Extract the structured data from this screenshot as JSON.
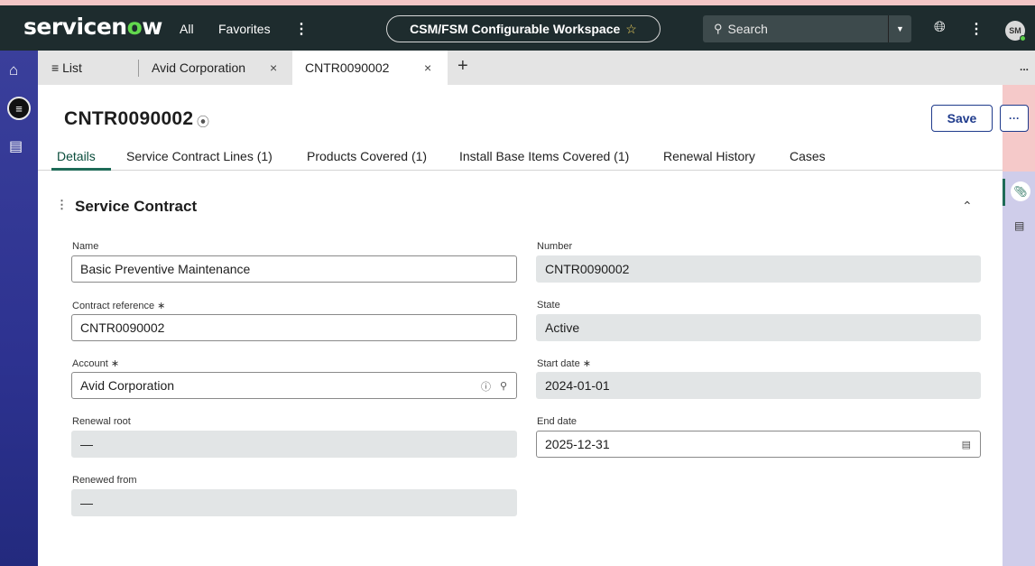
{
  "header": {
    "logo_text": "servicen",
    "logo_o": "o",
    "logo_tail": "w",
    "nav_all": "All",
    "nav_favorites": "Favorites",
    "nav_more": "⋮",
    "workspace_label": "CSM/FSM Configurable Workspace",
    "workspace_star": "☆",
    "search_placeholder": "Search",
    "avatar_initials": "SM"
  },
  "tabs": {
    "list_label": "List",
    "items": [
      {
        "label": "Avid Corporation",
        "close": "×"
      },
      {
        "label": "CNTR0090002",
        "close": "×"
      }
    ],
    "add": "+",
    "more": "..."
  },
  "record": {
    "title": "CNTR0090002",
    "save_label": "Save",
    "more_label": "···"
  },
  "subtabs": [
    "Details",
    "Service Contract Lines (1)",
    "Products Covered (1)",
    "Install Base Items Covered (1)",
    "Renewal History",
    "Cases"
  ],
  "section": {
    "title": "Service Contract"
  },
  "form": {
    "name": {
      "label": "Name",
      "value": "Basic Preventive Maintenance"
    },
    "contract_reference": {
      "label": "Contract reference",
      "value": "CNTR0090002"
    },
    "account": {
      "label": "Account",
      "value": "Avid Corporation"
    },
    "renewal_root": {
      "label": "Renewal root",
      "value": "—"
    },
    "renewed_from": {
      "label": "Renewed from",
      "value": "—"
    },
    "number": {
      "label": "Number",
      "value": "CNTR0090002"
    },
    "state": {
      "label": "State",
      "value": "Active"
    },
    "start_date": {
      "label": "Start date",
      "value": "2024-01-01"
    },
    "end_date": {
      "label": "End date",
      "value": "2025-12-31"
    },
    "required_mark": "∗"
  },
  "colors": {
    "topbar": "#1e2c2e",
    "rail": "#2d3290",
    "accent": "#1e6b57",
    "save_border": "#1f3b8c"
  }
}
